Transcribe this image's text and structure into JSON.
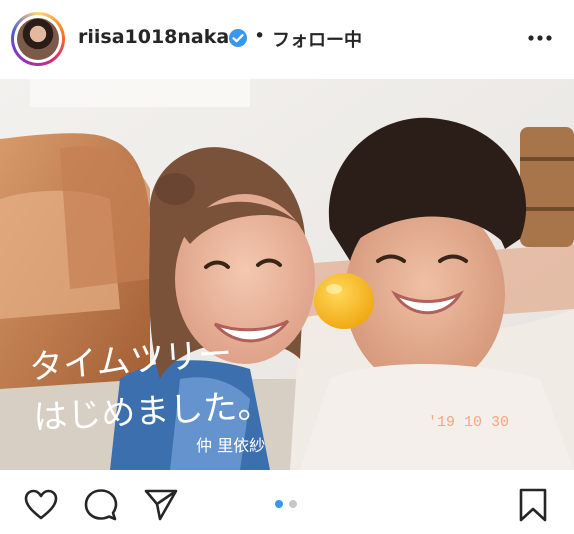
{
  "post": {
    "username": "riisa1018naka",
    "separator": "•",
    "follow_status": "フォロー中",
    "verified": true
  },
  "photo": {
    "caption_line1": "タイムツリー",
    "caption_line2": "はじめました。",
    "signature": "仲 里依紗",
    "date_stamp": "'19 10 30"
  },
  "carousel": {
    "total": 2,
    "active": 1
  },
  "icons": {
    "like": "heart-icon",
    "comment": "comment-bubble-icon",
    "share": "paper-plane-icon",
    "save": "bookmark-icon",
    "more": "more-dots-icon",
    "verified": "verified-badge-icon"
  },
  "colors": {
    "verified_blue": "#3897f0",
    "dot_active": "#3897f0",
    "dot_inactive": "#c7c7c7"
  }
}
